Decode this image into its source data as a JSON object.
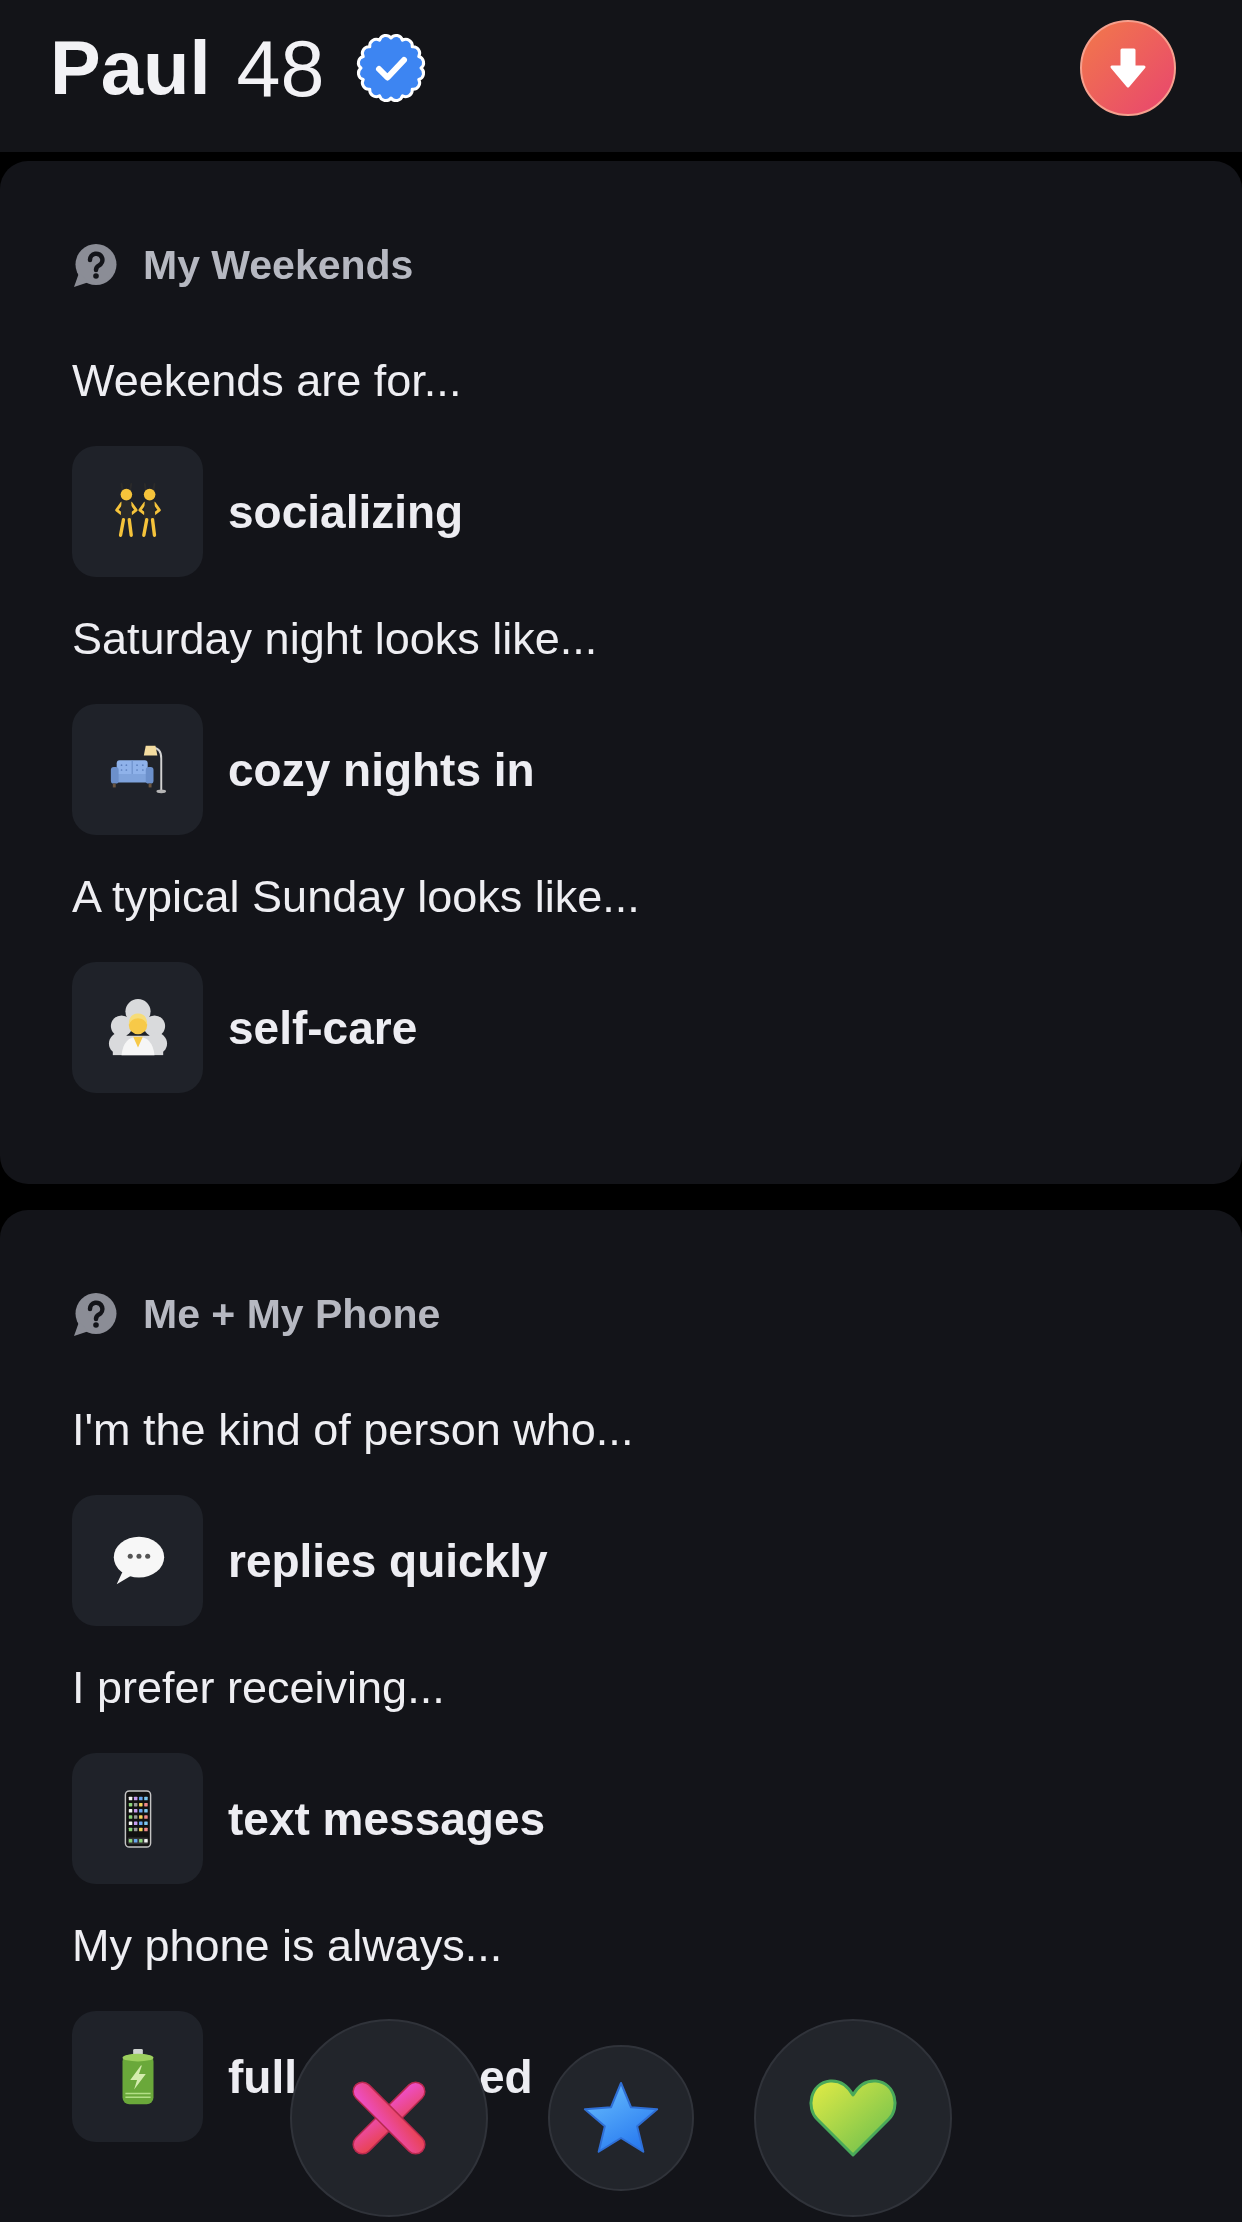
{
  "header": {
    "name": "Paul",
    "age": "48",
    "verified": true
  },
  "sections": [
    {
      "title": "My Weekends",
      "prompts": [
        {
          "question": "Weekends are for...",
          "answer": "socializing"
        },
        {
          "question": "Saturday night looks like...",
          "answer": "cozy nights in"
        },
        {
          "question": "A typical Sunday looks like...",
          "answer": "self-care"
        }
      ]
    },
    {
      "title": "Me + My Phone",
      "prompts": [
        {
          "question": "I'm the kind of person who...",
          "answer": "replies quickly"
        },
        {
          "question": "I prefer receiving...",
          "answer": "text messages"
        },
        {
          "question": "My phone is always...",
          "answer": "full",
          "answer_end": "ed"
        }
      ]
    }
  ]
}
